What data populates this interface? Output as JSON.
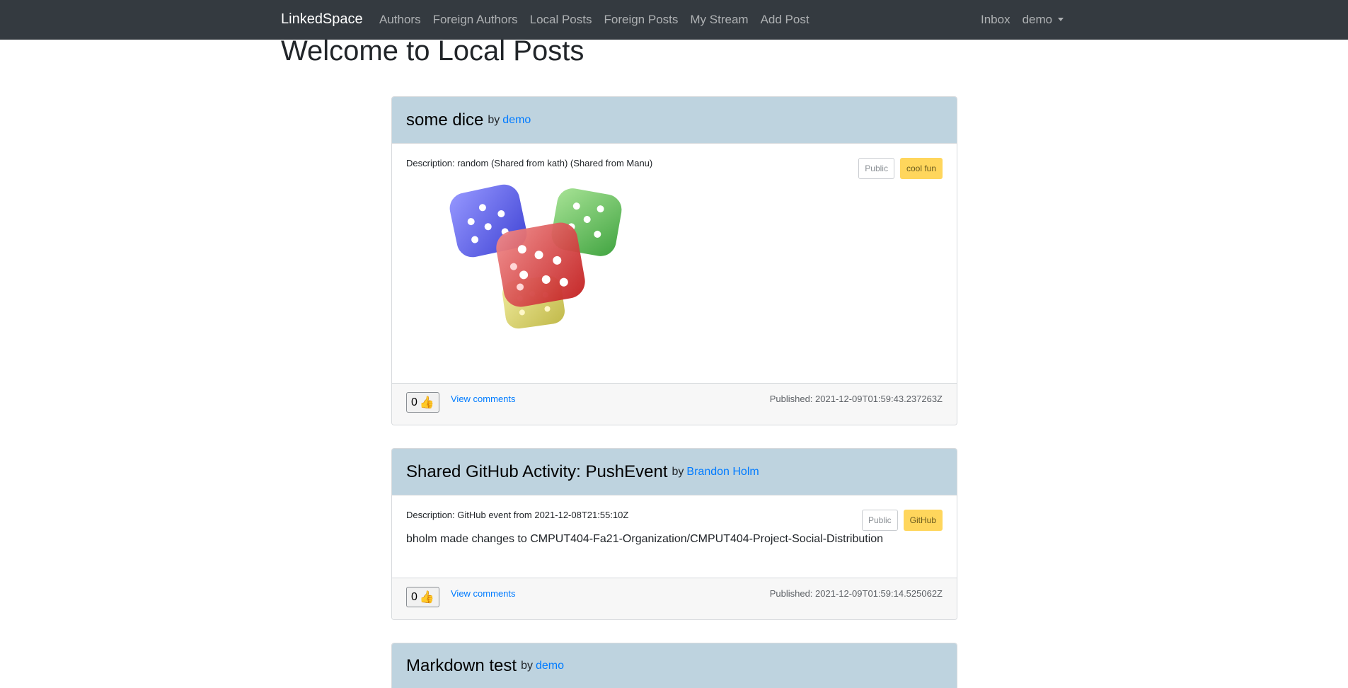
{
  "navbar": {
    "brand": "LinkedSpace",
    "links": [
      "Authors",
      "Foreign Authors",
      "Local Posts",
      "Foreign Posts",
      "My Stream",
      "Add Post"
    ],
    "inbox": "Inbox",
    "user": "demo"
  },
  "page_title": "Welcome to Local Posts",
  "posts": [
    {
      "title": "some dice",
      "by": "by",
      "author": "demo",
      "description": "Description: random (Shared from kath) (Shared from Manu)",
      "visibility": "Public",
      "tag": "cool fun",
      "likes": "0",
      "view_comments": "View comments",
      "published": "Published: 2021-12-09T01:59:43.237263Z"
    },
    {
      "title": "Shared GitHub Activity: PushEvent",
      "by": "by",
      "author": "Brandon Holm",
      "description": "Description: GitHub event from 2021-12-08T21:55:10Z",
      "content": "bholm made changes to CMPUT404-Fa21-Organization/CMPUT404-Project-Social-Distribution",
      "visibility": "Public",
      "tag": "GitHub",
      "likes": "0",
      "view_comments": "View comments",
      "published": "Published: 2021-12-09T01:59:14.525062Z"
    },
    {
      "title": "Markdown test",
      "by": "by",
      "author": "demo"
    }
  ],
  "colors": {
    "navbar_bg": "#343a40",
    "card_header_bg": "#bed3df",
    "link": "#007bff",
    "tag_bg": "#ffd65c"
  },
  "icons": {
    "like": "thumbs-up-icon",
    "user_menu": "caret-down-icon"
  }
}
